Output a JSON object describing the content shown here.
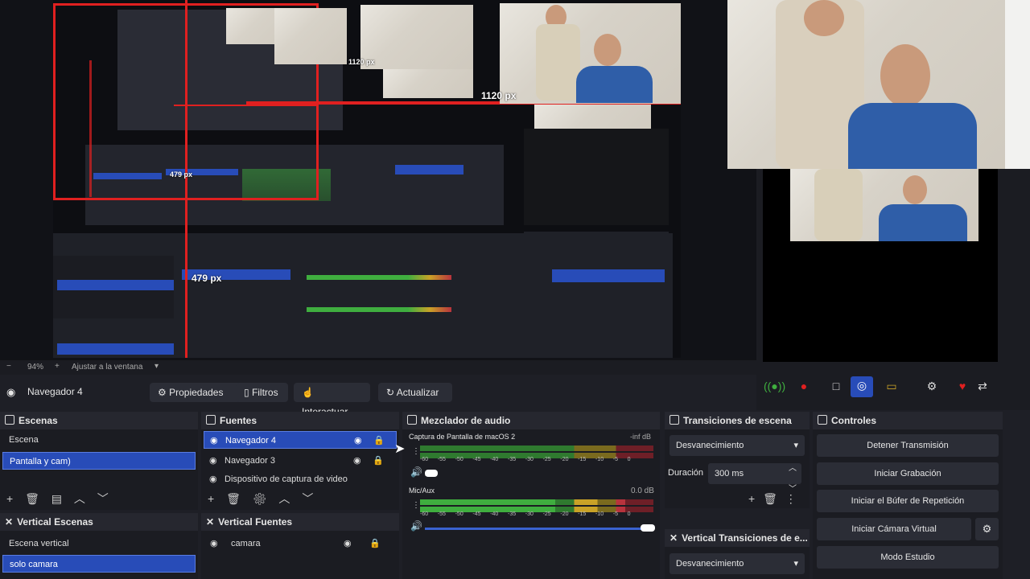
{
  "preview": {
    "label_1120_large": "1120 px",
    "label_1120_small": "1120 px",
    "label_479_large": "479 px",
    "label_479_small": "479 px"
  },
  "zoom": {
    "minus": "−",
    "percent": "94%",
    "plus": "+",
    "fit": "Ajustar a la ventana"
  },
  "source_toolbar": {
    "source_name": "Navegador 4",
    "properties": "Propiedades",
    "filters": "Filtros",
    "interact": "Interactuar",
    "refresh": "Actualizar"
  },
  "scenes": {
    "title": "Escenas",
    "items": [
      "Escena",
      "Pantalla y cam)"
    ]
  },
  "sources": {
    "title": "Fuentes",
    "items": [
      "Navegador 4",
      "Navegador 3",
      "Dispositivo de captura de video"
    ]
  },
  "mixer": {
    "title": "Mezclador de audio",
    "channels": [
      {
        "name": "Captura de Pantalla de macOS 2",
        "level": "-inf dB"
      },
      {
        "name": "Mic/Aux",
        "level": "0.0 dB"
      }
    ],
    "ticks": [
      "-60",
      "-55",
      "-50",
      "-45",
      "-40",
      "-35",
      "-30",
      "-25",
      "-20",
      "-15",
      "-10",
      "-5",
      "0"
    ]
  },
  "transitions": {
    "title": "Transiciones de escena",
    "selected": "Desvanecimiento",
    "duration_label": "Duración",
    "duration_value": "300 ms"
  },
  "controls": {
    "title": "Controles",
    "stop_stream": "Detener Transmisión",
    "start_recording": "Iniciar Grabación",
    "start_replay": "Iniciar el Búfer de Repetición",
    "start_vcam": "Iniciar Cámara Virtual",
    "studio_mode": "Modo Estudio"
  },
  "vertical_scenes": {
    "title": "Vertical Escenas",
    "items": [
      "Escena vertical",
      "solo camara"
    ]
  },
  "vertical_sources": {
    "title": "Vertical Fuentes",
    "items": [
      "camara"
    ]
  },
  "vertical_transitions": {
    "title": "Vertical Transiciones de e...",
    "selected": "Desvanecimiento"
  },
  "colors": {
    "accent": "#284cb8",
    "recording": "#e02020",
    "meter_green": "#3fae3f",
    "meter_yellow": "#c9a227",
    "meter_red": "#b8333d"
  }
}
